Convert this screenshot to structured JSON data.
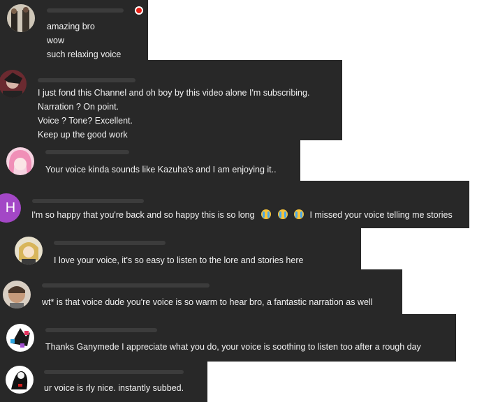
{
  "comments": [
    {
      "lines": [
        "amazing bro",
        "wow",
        "such relaxing voice"
      ]
    },
    {
      "lines": [
        "I just fond this Channel and oh boy by this video alone I'm subscribing.",
        "Narration ? On point.",
        "Voice ? Tone? Excellent.",
        "Keep up the good work"
      ]
    },
    {
      "lines": [
        "Your voice kinda sounds like Kazuha's and I am enjoying it.."
      ]
    },
    {
      "avatar_letter": "H",
      "avatar_color": "#a347c6",
      "text_before": "I'm so happy that you're back and so happy this is so long",
      "emoji": "loudly-crying-face-emoji",
      "text_after": "I missed your voice telling me stories"
    },
    {
      "lines": [
        "I love your voice, it's so easy to listen to the lore and stories here"
      ]
    },
    {
      "lines": [
        "wt* is that voice dude you're voice is so warm to hear bro, a fantastic narration as well"
      ]
    },
    {
      "lines": [
        "Thanks Ganymede I appreciate what you do, your voice is soothing to listen too after a rough day"
      ]
    },
    {
      "lines": [
        "ur voice is rly nice. instantly subbed."
      ]
    }
  ]
}
